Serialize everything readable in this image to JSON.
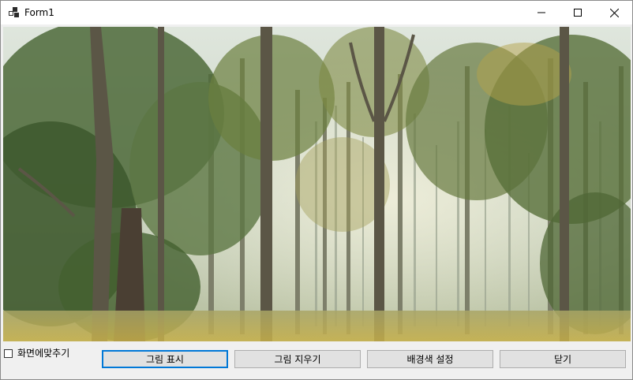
{
  "window": {
    "title": "Form1",
    "controls": {
      "minimize": "minimize-icon",
      "maximize": "maximize-icon",
      "close": "close-icon"
    }
  },
  "picture": {
    "content": "forest-photo"
  },
  "options": {
    "fit_to_screen_label": "화면에맞추기",
    "fit_to_screen_checked": false
  },
  "buttons": {
    "show_image": "그림 표시",
    "clear_image": "그림 지우기",
    "set_background": "배경색 설정",
    "close": "닫기"
  },
  "colors": {
    "focus_accent": "#0078d7",
    "button_face": "#e1e1e1",
    "window_bg": "#f0f0f0"
  }
}
